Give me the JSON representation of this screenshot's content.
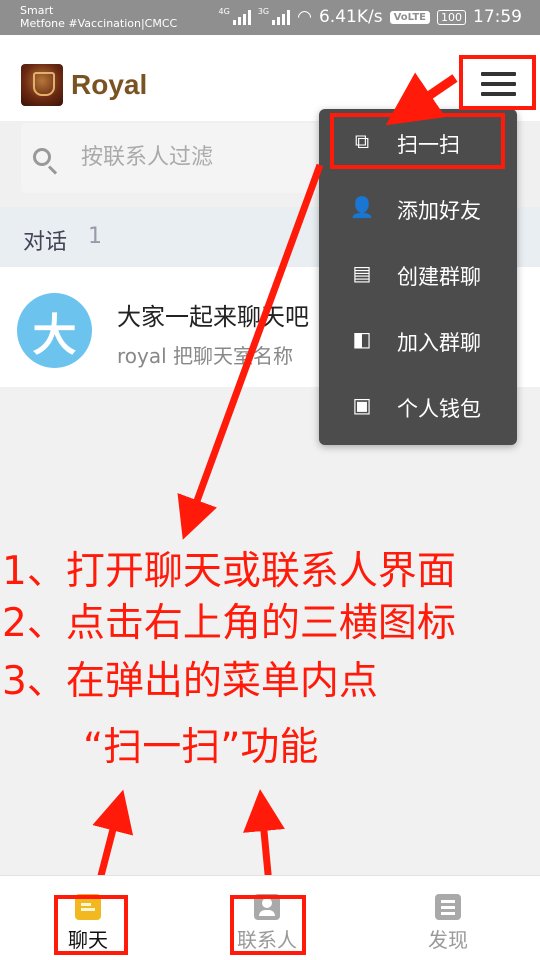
{
  "status_bar": {
    "carrier_line1": "Smart",
    "carrier_line2": "Metfone #Vaccination|CMCC",
    "net1": "4G",
    "net2": "3G",
    "speed": "6.41K/s",
    "volte": "VoLTE",
    "battery": "100",
    "time": "17:59"
  },
  "header": {
    "title": "Royal",
    "menu_icon": "hamburger-icon"
  },
  "search": {
    "placeholder": "按联系人过滤",
    "value": ""
  },
  "section": {
    "title": "对话",
    "count": "1"
  },
  "conversation": {
    "avatar_text": "大",
    "title": "大家一起来聊天吧",
    "preview": "royal 把聊天室名称"
  },
  "popup_menu": {
    "items": [
      {
        "label": "扫一扫",
        "icon": "scan-icon"
      },
      {
        "label": "添加好友",
        "icon": "add-friend-icon"
      },
      {
        "label": "创建群聊",
        "icon": "create-group-icon"
      },
      {
        "label": "加入群聊",
        "icon": "join-group-icon"
      },
      {
        "label": "个人钱包",
        "icon": "wallet-icon"
      }
    ]
  },
  "instructions": {
    "line1": "1、打开聊天或联系人界面",
    "line2": "2、点击右上角的三横图标",
    "line3": "3、在弹出的菜单内点",
    "line4": "“扫一扫”功能"
  },
  "bottom_nav": {
    "chat": "聊天",
    "contacts": "联系人",
    "discover": "发现"
  },
  "colors": {
    "annotation": "#ff1a0a",
    "brand": "#7a5323",
    "avatar": "#6cc4ee",
    "popup": "#4c4c4c"
  }
}
